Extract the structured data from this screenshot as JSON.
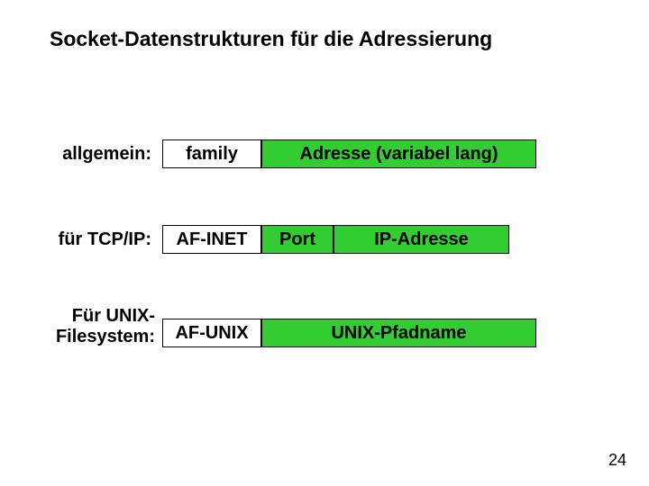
{
  "title": "Socket-Datenstrukturen für die Adressierung",
  "rows": {
    "general": {
      "label": "allgemein:",
      "family": "family",
      "address": "Adresse (variabel lang)"
    },
    "tcpip": {
      "label": "für TCP/IP:",
      "family": "AF-INET",
      "port": "Port",
      "ip": "IP-Adresse"
    },
    "unix": {
      "label_line1": "Für UNIX-",
      "label_line2": "Filesystem:",
      "family": "AF-UNIX",
      "path": "UNIX-Pfadname"
    }
  },
  "page_number": "24"
}
